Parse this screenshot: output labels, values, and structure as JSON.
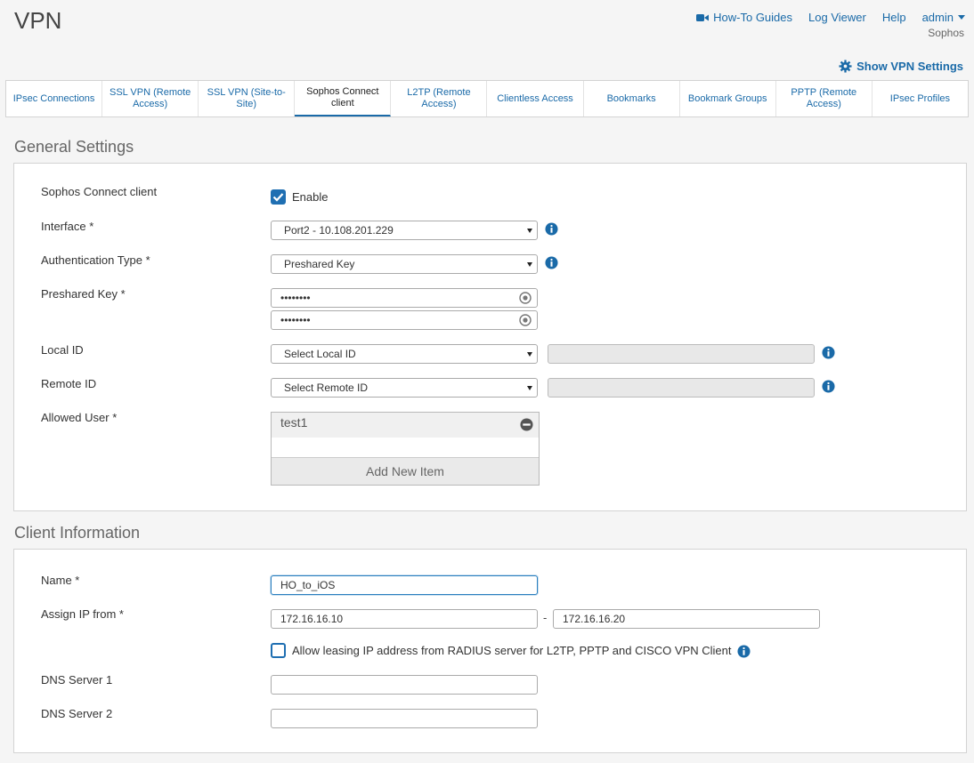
{
  "header": {
    "title": "VPN",
    "links": {
      "howto": "How-To Guides",
      "logviewer": "Log Viewer",
      "help": "Help",
      "user": "admin"
    },
    "org": "Sophos",
    "show_settings": "Show VPN Settings"
  },
  "tabs": [
    {
      "label": "IPsec Connections"
    },
    {
      "label": "SSL VPN (Remote Access)"
    },
    {
      "label": "SSL VPN (Site-to-Site)"
    },
    {
      "label": "Sophos Connect client",
      "active": true
    },
    {
      "label": "L2TP (Remote Access)"
    },
    {
      "label": "Clientless Access"
    },
    {
      "label": "Bookmarks"
    },
    {
      "label": "Bookmark Groups"
    },
    {
      "label": "PPTP (Remote Access)"
    },
    {
      "label": "IPsec Profiles"
    }
  ],
  "general": {
    "title": "General Settings",
    "client_label": "Sophos Connect client",
    "enable_label": "Enable",
    "interface_label": "Interface *",
    "interface_value": "Port2 - 10.108.201.229",
    "auth_label": "Authentication Type *",
    "auth_value": "Preshared Key",
    "psk_label": "Preshared Key *",
    "psk_value": "••••••••",
    "psk_confirm_value": "••••••••",
    "localid_label": "Local ID",
    "localid_value": "Select Local ID",
    "remoteid_label": "Remote ID",
    "remoteid_value": "Select Remote ID",
    "allowed_label": "Allowed User *",
    "allowed_users": [
      "test1"
    ],
    "add_item": "Add New Item"
  },
  "client": {
    "title": "Client Information",
    "name_label": "Name *",
    "name_value": "HO_to_iOS",
    "assign_label": "Assign IP from *",
    "ip_from": "172.16.16.10",
    "ip_dash": "-",
    "ip_to": "172.16.16.20",
    "radius_label": "Allow leasing IP address from RADIUS server for L2TP, PPTP and CISCO VPN Client",
    "dns1_label": "DNS Server 1",
    "dns1_value": "",
    "dns2_label": "DNS Server 2",
    "dns2_value": ""
  },
  "colors": {
    "accent": "#1a6aa8",
    "checkbox": "#1f6fb2"
  }
}
